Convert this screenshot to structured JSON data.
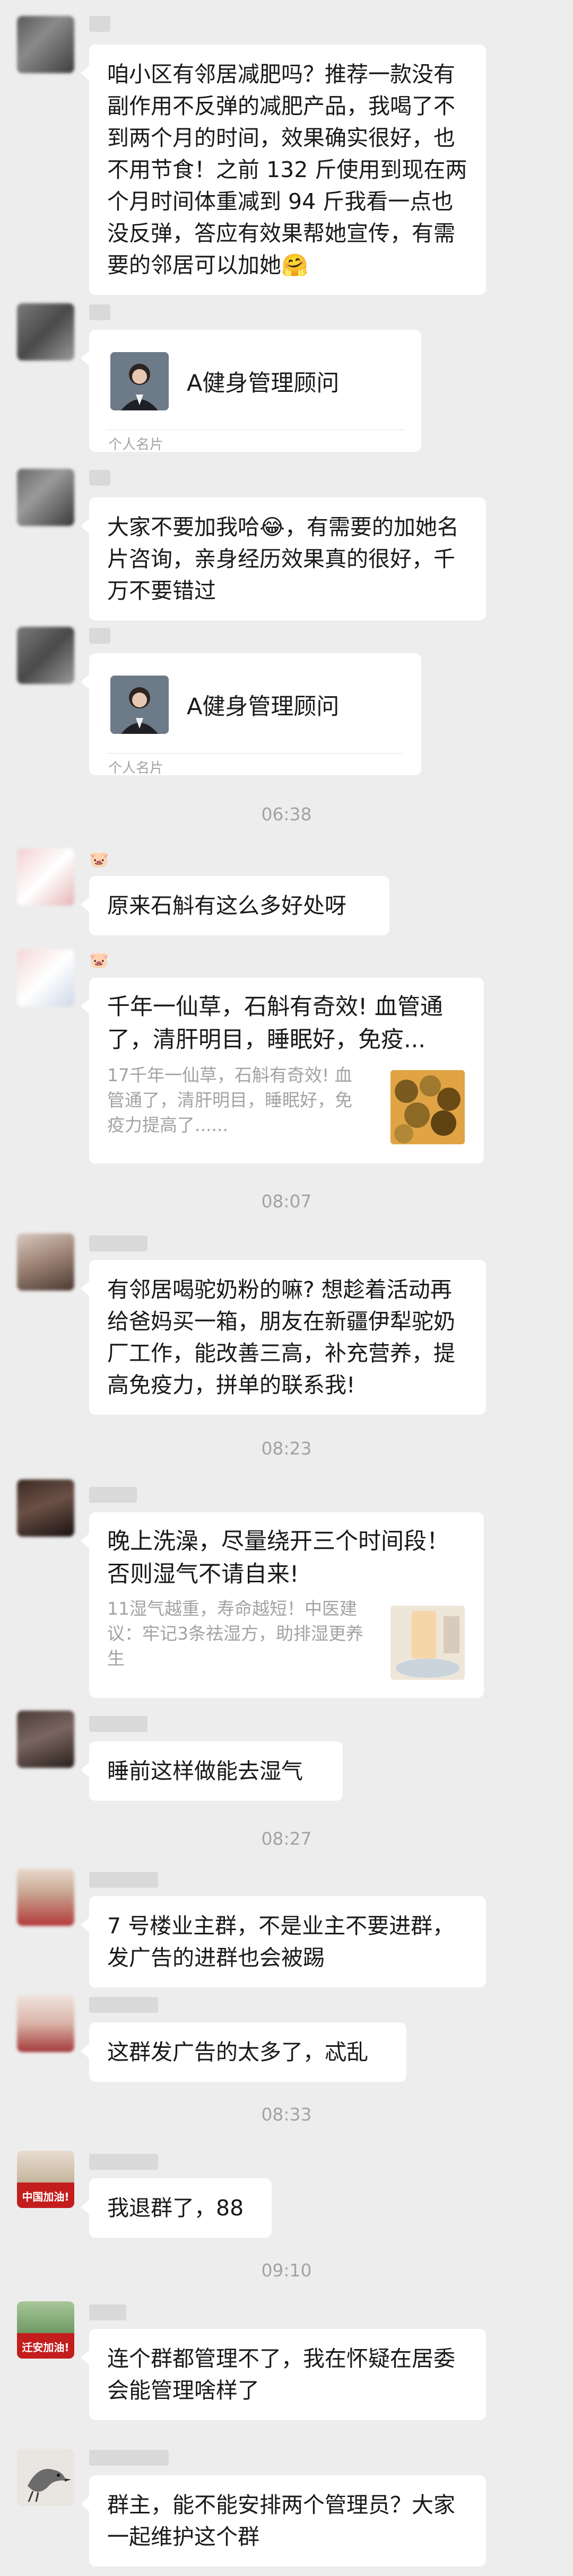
{
  "messages": {
    "m1_text": "咱小区有邻居减肥吗？推荐一款没有副作用不反弹的减肥产品，我喝了不到两个月的时间，效果确实很好，也不用节食！之前 132 斤使用到现在两个月时间体重减到 94 斤我看一点也没反弹，答应有效果帮她宣传，有需要的邻居可以加她🤗",
    "card1_name": "A健身管理顾问",
    "card1_foot": "个人名片",
    "m3_text": "大家不要加我哈😂，有需要的加她名片咨询，亲身经历效果真的很好，千万不要错过",
    "card2_name": "A健身管理顾问",
    "card2_foot": "个人名片",
    "time1": "06:38",
    "m5_text": "原来石斛有这么多好处呀",
    "link1_title": "千年一仙草，石斛有奇效! 血管通了，清肝明目，睡眠好，免疫...",
    "link1_desc": "17千年一仙草，石斛有奇效! 血管通了，清肝明目，睡眠好，免疫力提高了......",
    "time2": "08:07",
    "m7_text": "有邻居喝驼奶粉的嘛? 想趁着活动再给爸妈买一箱，朋友在新疆伊犁驼奶厂工作，能改善三高，补充营养，提高免疫力，拼单的联系我!",
    "time3": "08:23",
    "link2_title": "晚上洗澡，尽量绕开三个时间段！否则湿气不请自来!",
    "link2_desc": "11湿气越重，寿命越短！中医建议：牢记3条祛湿方，助排湿更养生",
    "m9_text": "睡前这样做能去湿气",
    "time4": "08:27",
    "m10_text": "7 号楼业主群，不是业主不要进群，发广告的进群也会被踢",
    "m11_text": "这群发广告的太多了，忒乱",
    "time5": "08:33",
    "m12_text": "我退群了，88",
    "time6": "09:10",
    "m13_text": "连个群都管理不了，我在怀疑在居委会能管理啥样了",
    "m14_text": "群主，能不能安排两个管理员？大家一起维护这个群",
    "avatar_label_1": "中国加油!",
    "avatar_label_2": "迁安加油!"
  },
  "colors": {
    "background": "#ededed",
    "bubble": "#ffffff",
    "text": "#191919",
    "muted": "#a3a3a3"
  }
}
